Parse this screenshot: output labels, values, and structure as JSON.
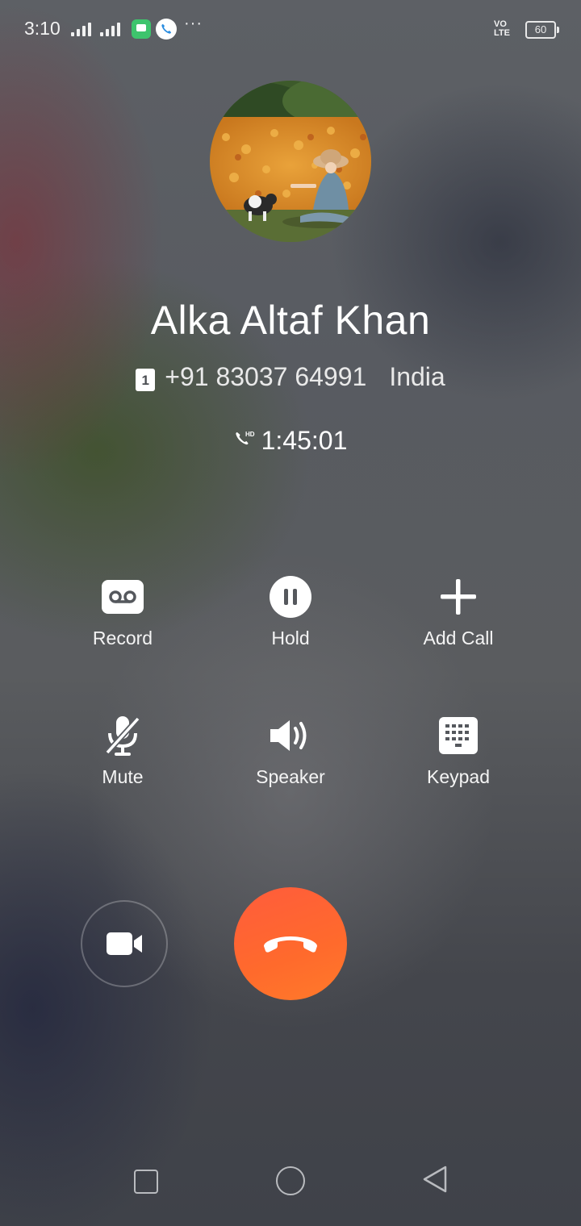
{
  "status_bar": {
    "time": "3:10",
    "more": "···",
    "network": "VO LTE",
    "battery": "60"
  },
  "caller": {
    "name": "Alka Altaf Khan",
    "sim_slot": "1",
    "number": "+91 83037 64991",
    "country": "India",
    "call_quality_icon": "hd-call-icon",
    "duration": "1:45:01"
  },
  "controls": {
    "record": "Record",
    "hold": "Hold",
    "add_call": "Add Call",
    "mute": "Mute",
    "speaker": "Speaker",
    "keypad": "Keypad"
  },
  "actions": {
    "video_icon": "video-camera-icon",
    "end_call_icon": "end-call-icon",
    "end_call_color": "#ff6334"
  },
  "nav": {
    "recent_icon": "square-icon",
    "home_icon": "circle-icon",
    "back_icon": "triangle-back-icon"
  }
}
